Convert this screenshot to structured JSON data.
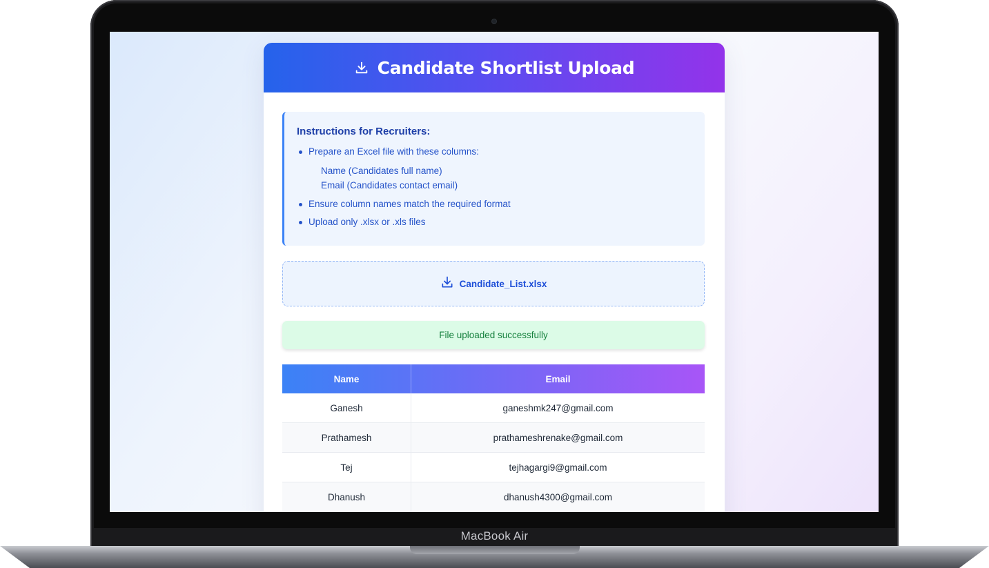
{
  "device": {
    "brand_label": "MacBook Air"
  },
  "header": {
    "title": "Candidate Shortlist Upload",
    "icon": "download-icon",
    "gradient": [
      "#2563eb",
      "#9333ea"
    ]
  },
  "instructions": {
    "title": "Instructions for Recruiters:",
    "items": [
      "Prepare an Excel file with these columns:",
      "Ensure column names match the required format",
      "Upload only .xlsx or .xls files"
    ],
    "sub_items": [
      "Name (Candidates full name)",
      "Email (Candidates contact email)"
    ]
  },
  "upload": {
    "icon": "download-icon",
    "file_name": "Candidate_List.xlsx"
  },
  "status": {
    "message": "File uploaded successfully",
    "color": "#15803d"
  },
  "table": {
    "headers": [
      "Name",
      "Email"
    ],
    "rows": [
      {
        "name": "Ganesh",
        "email": "ganeshmk247@gmail.com"
      },
      {
        "name": "Prathamesh",
        "email": "prathameshrenake@gmail.com"
      },
      {
        "name": "Tej",
        "email": "tejhagargi9@gmail.com"
      },
      {
        "name": "Dhanush",
        "email": "dhanush4300@gmail.com"
      }
    ]
  }
}
